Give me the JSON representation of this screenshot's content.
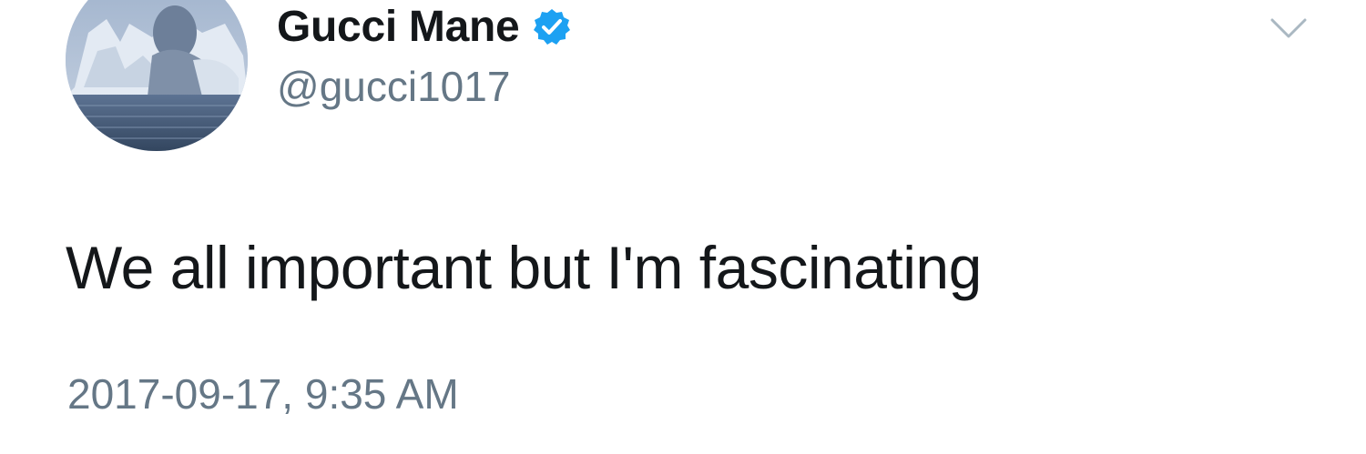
{
  "user": {
    "display_name": "Gucci Mane",
    "handle": "@gucci1017",
    "verified": true,
    "avatar_icon": "profile-photo-avatar"
  },
  "menu": {
    "icon": "chevron-down-icon"
  },
  "tweet": {
    "text": "We all important but I'm fascinating",
    "timestamp": "2017-09-17, 9:35 AM"
  },
  "colors": {
    "text_primary": "#14171a",
    "text_secondary": "#657786",
    "verified_blue": "#1da1f2",
    "caret": "#aab8c2"
  }
}
